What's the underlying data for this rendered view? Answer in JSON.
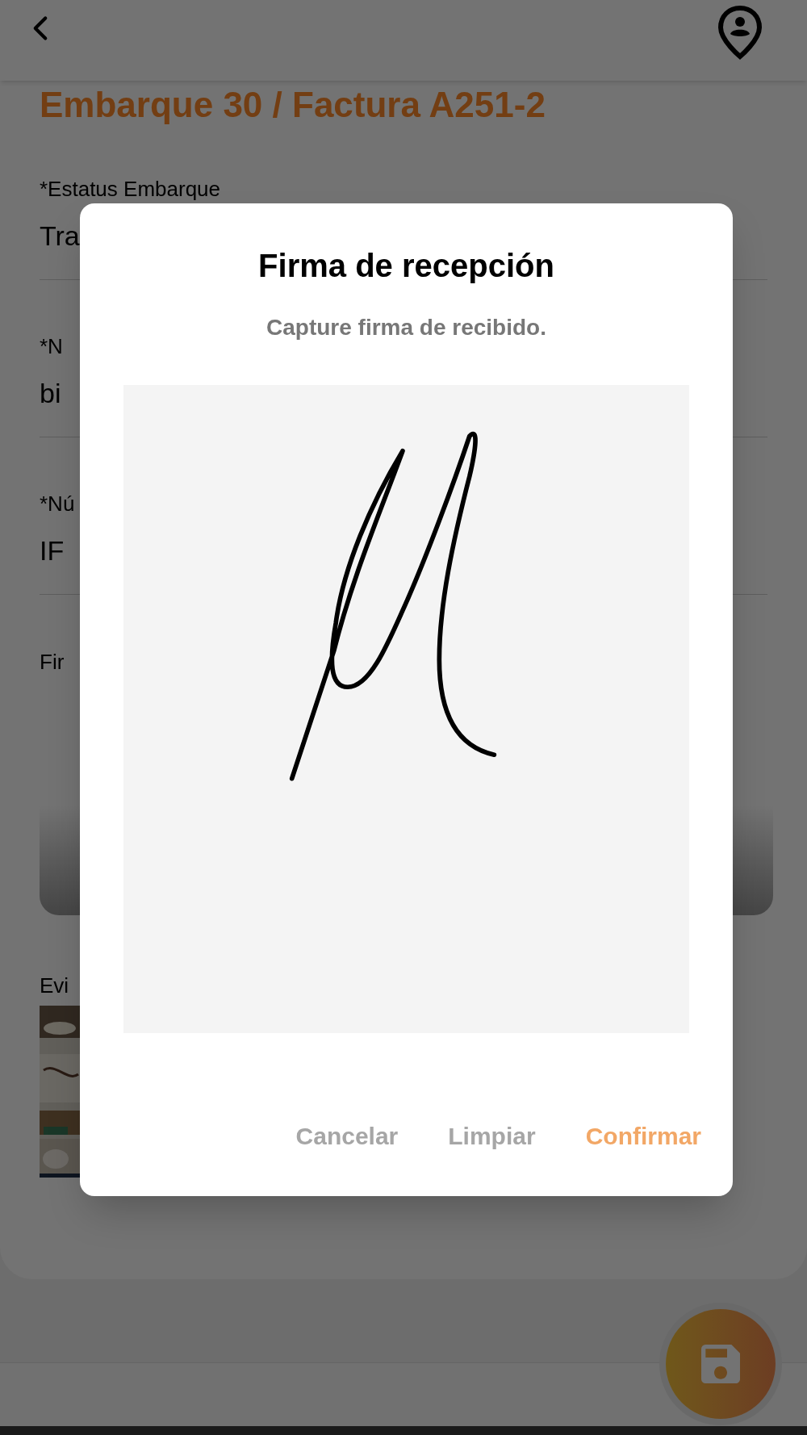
{
  "page_title": "Embarque 30 / Factura A251-2",
  "fields": [
    {
      "label": "*Estatus Embarque",
      "value": "Tra"
    },
    {
      "label": "*N",
      "value": "bi"
    },
    {
      "label": "*Nú",
      "value": "IF"
    }
  ],
  "signature_label": "Fir",
  "evidence_label": "Evi",
  "dialog": {
    "title": "Firma de recepción",
    "subtitle": "Capture firma de recibido.",
    "buttons": [
      {
        "label": "Cancelar",
        "kind": "neutral"
      },
      {
        "label": "Limpiar",
        "kind": "neutral"
      },
      {
        "label": "Confirmar",
        "kind": "primary"
      }
    ]
  }
}
